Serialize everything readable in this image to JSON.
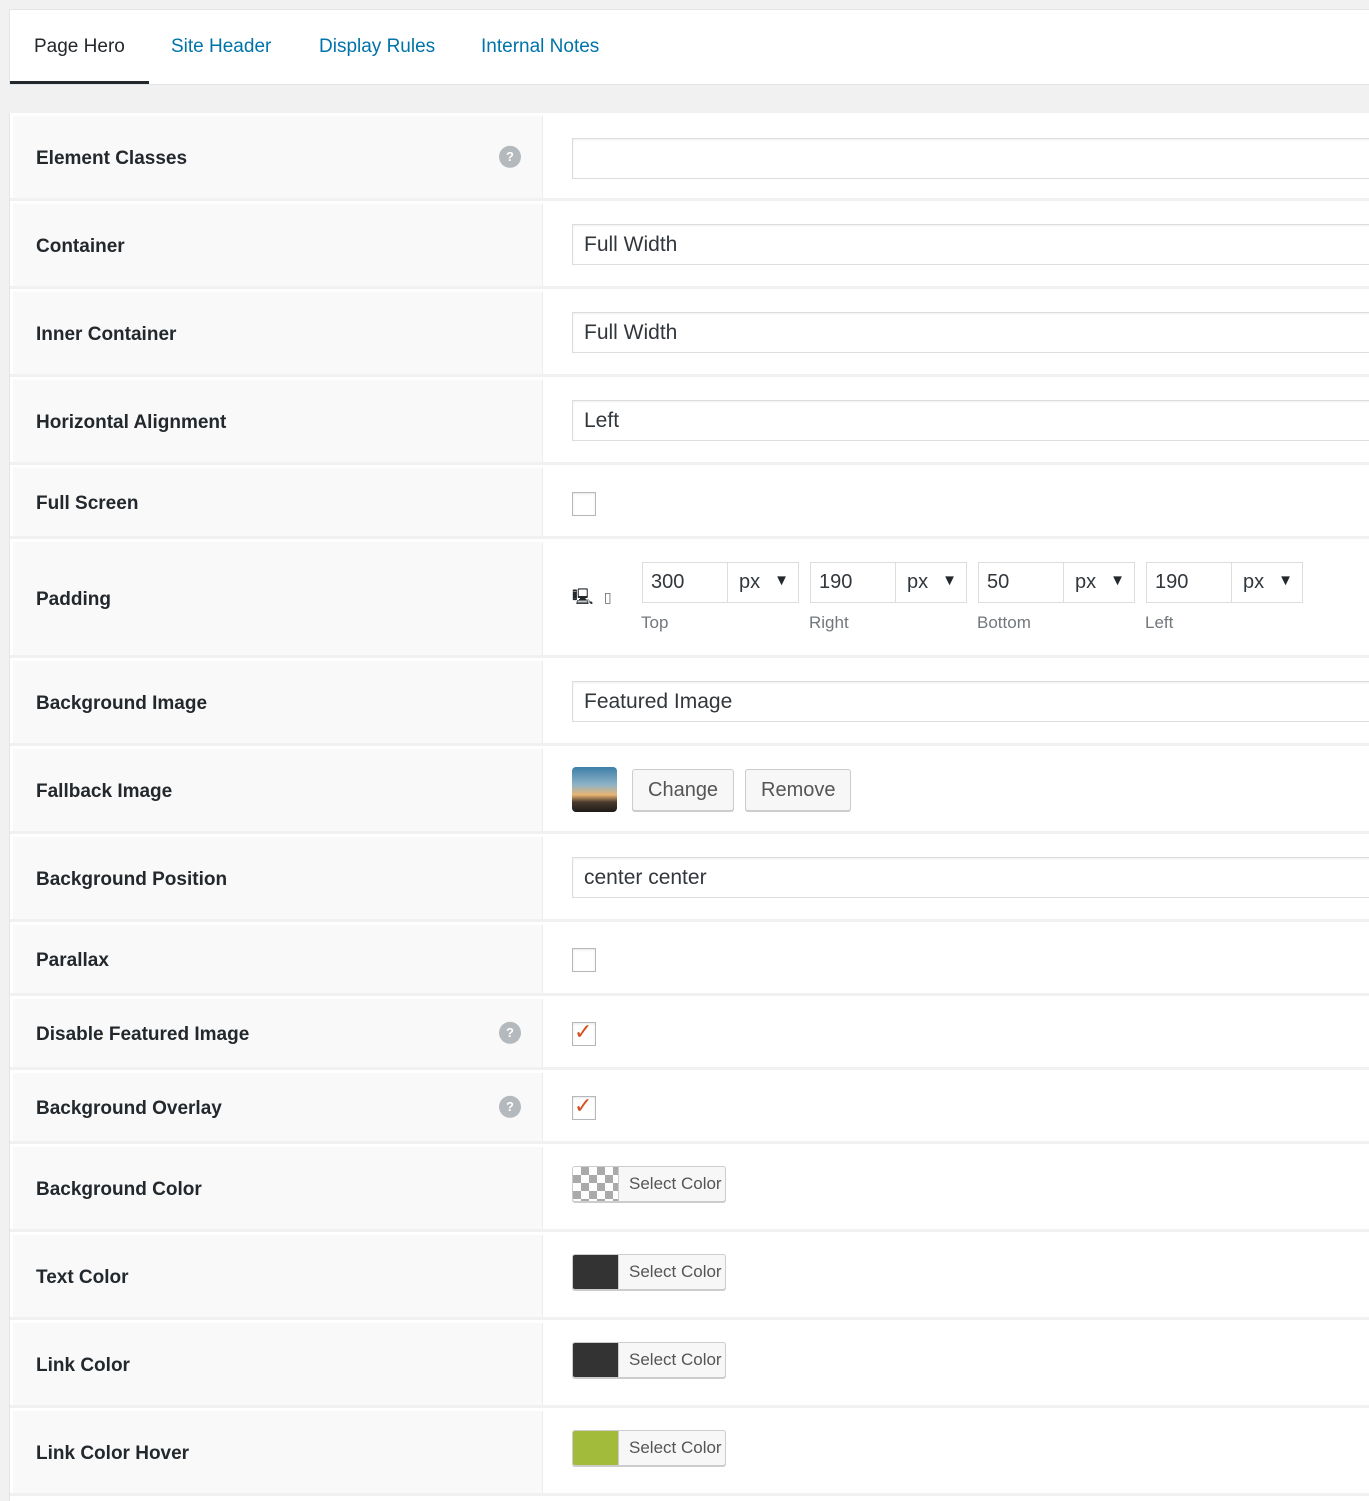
{
  "tabs": [
    "Page Hero",
    "Site Header",
    "Display Rules",
    "Internal Notes"
  ],
  "fields": {
    "element_classes": {
      "label": "Element Classes",
      "value": ""
    },
    "container": {
      "label": "Container",
      "value": "Full Width"
    },
    "inner_container": {
      "label": "Inner Container",
      "value": "Full Width"
    },
    "horizontal_alignment": {
      "label": "Horizontal Alignment",
      "value": "Left"
    },
    "full_screen": {
      "label": "Full Screen",
      "checked": false
    },
    "padding": {
      "label": "Padding",
      "top": {
        "value": "300",
        "unit": "px",
        "caption": "Top"
      },
      "right": {
        "value": "190",
        "unit": "px",
        "caption": "Right"
      },
      "bottom": {
        "value": "50",
        "unit": "px",
        "caption": "Bottom"
      },
      "left": {
        "value": "190",
        "unit": "px",
        "caption": "Left"
      }
    },
    "background_image": {
      "label": "Background Image",
      "value": "Featured Image"
    },
    "fallback_image": {
      "label": "Fallback Image",
      "change": "Change",
      "remove": "Remove"
    },
    "background_position": {
      "label": "Background Position",
      "value": "center center"
    },
    "parallax": {
      "label": "Parallax",
      "checked": false
    },
    "disable_featured_image": {
      "label": "Disable Featured Image",
      "checked": true
    },
    "background_overlay": {
      "label": "Background Overlay",
      "checked": true
    },
    "background_color": {
      "label": "Background Color",
      "button": "Select Color",
      "color": "transparent"
    },
    "text_color": {
      "label": "Text Color",
      "button": "Select Color",
      "color": "#333333"
    },
    "link_color": {
      "label": "Link Color",
      "button": "Select Color",
      "color": "#333333"
    },
    "link_color_hover": {
      "label": "Link Color Hover",
      "button": "Select Color",
      "color": "#a3bb3a"
    }
  },
  "help_icon": "?",
  "tick": "✓"
}
